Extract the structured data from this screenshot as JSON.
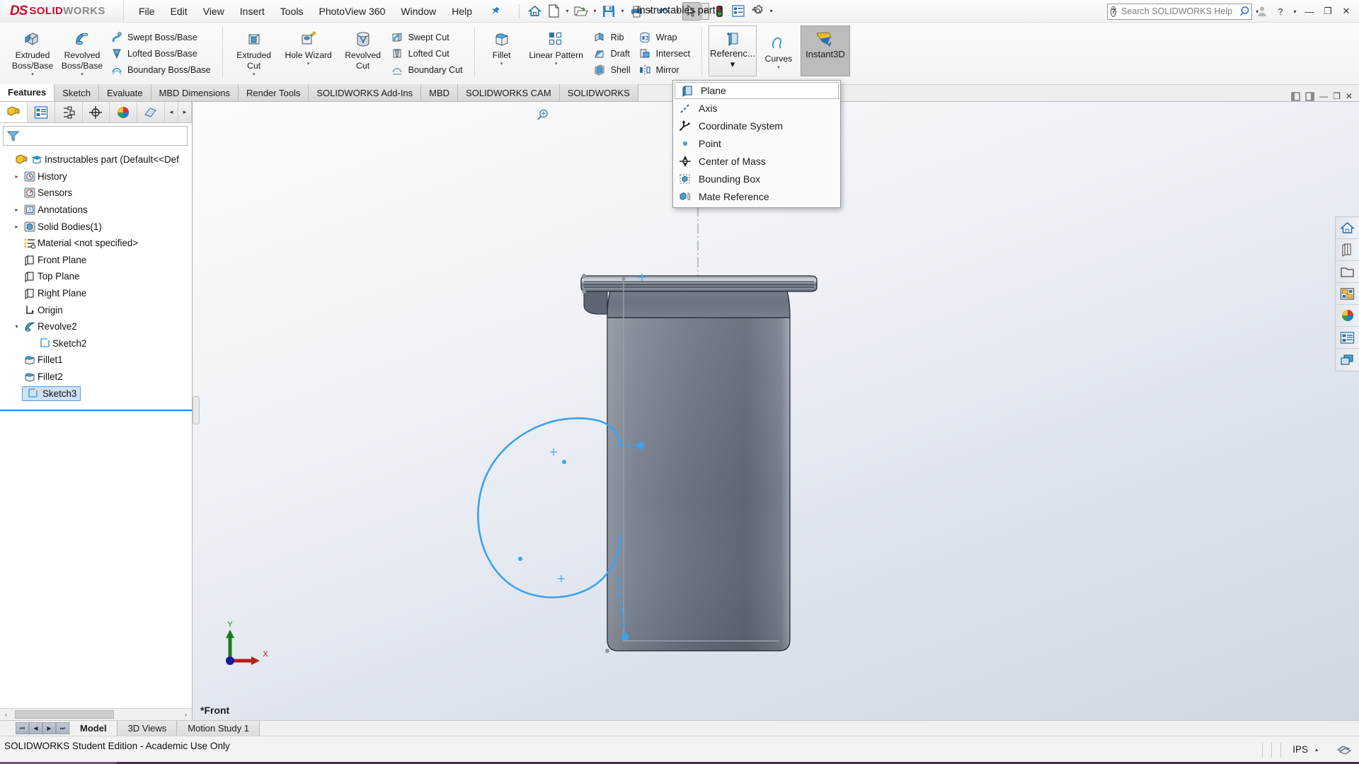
{
  "app": {
    "brand_mark": "DS",
    "brand_solid": "SOLID",
    "brand_works": "WORKS",
    "document_title": "Instructables part *",
    "accent_color": "#cf0a2c"
  },
  "menubar": {
    "items": [
      {
        "label": "File"
      },
      {
        "label": "Edit"
      },
      {
        "label": "View"
      },
      {
        "label": "Insert"
      },
      {
        "label": "Tools"
      },
      {
        "label": "PhotoView 360"
      },
      {
        "label": "Window"
      },
      {
        "label": "Help"
      }
    ],
    "pin_icon": "pushpin-icon"
  },
  "quick_access": {
    "buttons": [
      {
        "name": "home-icon"
      },
      {
        "name": "new-document-icon"
      },
      {
        "name": "open-folder-icon"
      },
      {
        "name": "save-icon"
      },
      {
        "name": "print-icon"
      },
      {
        "name": "undo-icon"
      },
      {
        "name": "select-cursor-icon"
      },
      {
        "name": "rebuild-traffic-light-icon"
      },
      {
        "name": "options-list-icon"
      },
      {
        "name": "settings-gear-icon"
      }
    ]
  },
  "search": {
    "placeholder": "Search SOLIDWORKS Help",
    "value": "",
    "help_icon": "question-circle-icon",
    "magnifier_icon": "magnifier-icon"
  },
  "window_controls": {
    "account": "user-account-icon",
    "help": "?",
    "help_caret": "▾",
    "minimize": "—",
    "restore": "❐",
    "close": "✕"
  },
  "ribbon": {
    "groups": [
      {
        "name": "boss-base-group",
        "big": [
          {
            "label_line1": "Extruded",
            "label_line2": "Boss/Base",
            "icon": "extruded-boss-icon",
            "dropdown": true
          },
          {
            "label_line1": "Revolved",
            "label_line2": "Boss/Base",
            "icon": "revolved-boss-icon",
            "dropdown": true
          }
        ],
        "small": [
          {
            "label": "Swept Boss/Base",
            "icon": "swept-boss-icon"
          },
          {
            "label": "Lofted Boss/Base",
            "icon": "lofted-boss-icon"
          },
          {
            "label": "Boundary Boss/Base",
            "icon": "boundary-boss-icon"
          }
        ]
      },
      {
        "name": "cut-group",
        "big": [
          {
            "label_line1": "Extruded",
            "label_line2": "Cut",
            "icon": "extruded-cut-icon",
            "dropdown": true
          },
          {
            "label_line1": "Hole Wizard",
            "label_line2": "",
            "icon": "hole-wizard-icon",
            "dropdown": true
          },
          {
            "label_line1": "Revolved",
            "label_line2": "Cut",
            "icon": "revolved-cut-icon",
            "dropdown": false
          }
        ],
        "small": [
          {
            "label": "Swept Cut",
            "icon": "swept-cut-icon"
          },
          {
            "label": "Lofted Cut",
            "icon": "lofted-cut-icon"
          },
          {
            "label": "Boundary Cut",
            "icon": "boundary-cut-icon"
          }
        ]
      },
      {
        "name": "features-group",
        "big": [
          {
            "label_line1": "Fillet",
            "label_line2": "",
            "icon": "fillet-icon",
            "dropdown": true
          },
          {
            "label_line1": "Linear Pattern",
            "label_line2": "",
            "icon": "linear-pattern-icon",
            "dropdown": true
          }
        ],
        "small": [
          {
            "label": "Rib",
            "icon": "rib-icon"
          },
          {
            "label": "Draft",
            "icon": "draft-icon"
          },
          {
            "label": "Shell",
            "icon": "shell-icon"
          }
        ],
        "small2": [
          {
            "label": "Wrap",
            "icon": "wrap-icon"
          },
          {
            "label": "Intersect",
            "icon": "intersect-icon"
          },
          {
            "label": "Mirror",
            "icon": "mirror-icon"
          }
        ]
      },
      {
        "name": "reference-group",
        "reference": {
          "label": "Referenc...",
          "icon": "reference-geometry-plane-icon",
          "dropdown": true,
          "active": true
        },
        "curves": {
          "label": "Curves",
          "icon": "curves-icon",
          "dropdown": true
        },
        "instant3d": {
          "label": "Instant3D",
          "icon": "instant3d-icon",
          "pressed": true
        }
      }
    ]
  },
  "ribbon_tabs": {
    "items": [
      {
        "label": "Features",
        "active": true
      },
      {
        "label": "Sketch",
        "active": false
      },
      {
        "label": "Evaluate",
        "active": false
      },
      {
        "label": "MBD Dimensions",
        "active": false
      },
      {
        "label": "Render Tools",
        "active": false
      },
      {
        "label": "SOLIDWORKS Add-Ins",
        "active": false
      },
      {
        "label": "MBD",
        "active": false
      },
      {
        "label": "SOLIDWORKS CAM",
        "active": false
      },
      {
        "label": "SOLIDWORKS",
        "active": false
      }
    ],
    "right_controls": [
      {
        "name": "panel-collapse-left-icon",
        "glyph": "⎮|"
      },
      {
        "name": "panel-collapse-right-icon",
        "glyph": "|⎮"
      },
      {
        "name": "window-minimize-icon",
        "glyph": "—"
      },
      {
        "name": "window-restore-icon",
        "glyph": "❐"
      },
      {
        "name": "window-close-icon",
        "glyph": "✕"
      }
    ]
  },
  "reference_dropdown": {
    "open": true,
    "items": [
      {
        "label": "Plane",
        "icon": "plane-icon",
        "highlighted": true
      },
      {
        "label": "Axis",
        "icon": "axis-icon",
        "highlighted": false
      },
      {
        "label": "Coordinate System",
        "icon": "coordinate-system-icon",
        "highlighted": false
      },
      {
        "label": "Point",
        "icon": "point-icon",
        "highlighted": false
      },
      {
        "label": "Center of Mass",
        "icon": "center-of-mass-icon",
        "highlighted": false
      },
      {
        "label": "Bounding Box",
        "icon": "bounding-box-icon",
        "highlighted": false
      },
      {
        "label": "Mate Reference",
        "icon": "mate-reference-icon",
        "highlighted": false
      }
    ]
  },
  "left_panel": {
    "tabs": [
      {
        "name": "feature-manager-tab",
        "icon": "feature-tree-icon",
        "active": true
      },
      {
        "name": "property-manager-tab",
        "icon": "property-manager-icon",
        "active": false
      },
      {
        "name": "configuration-manager-tab",
        "icon": "configuration-manager-icon",
        "active": false
      },
      {
        "name": "dimxpert-manager-tab",
        "icon": "dimxpert-icon",
        "active": false
      },
      {
        "name": "display-manager-tab",
        "icon": "display-manager-icon",
        "active": false
      },
      {
        "name": "extra-manager-tab",
        "icon": "cam-manager-icon",
        "active": false
      }
    ],
    "arrows": [
      "◂",
      "▸"
    ],
    "filter": {
      "placeholder": "",
      "value": "",
      "icon": "filter-funnel-icon"
    },
    "tree": [
      {
        "label": "Instructables part  (Default<<Def",
        "icon": "part-doc-icon",
        "icon2": "graduation-cap-icon",
        "indent": 0,
        "expander": "",
        "selected": false
      },
      {
        "label": "History",
        "icon": "history-icon",
        "indent": 1,
        "expander": "▸",
        "selected": false
      },
      {
        "label": "Sensors",
        "icon": "sensors-icon",
        "indent": 1,
        "expander": "",
        "selected": false
      },
      {
        "label": "Annotations",
        "icon": "annotations-icon",
        "indent": 1,
        "expander": "▸",
        "selected": false
      },
      {
        "label": "Solid Bodies(1)",
        "icon": "solid-bodies-icon",
        "indent": 1,
        "expander": "▸",
        "selected": false
      },
      {
        "label": "Material <not specified>",
        "icon": "material-icon",
        "indent": 1,
        "expander": "",
        "selected": false
      },
      {
        "label": "Front Plane",
        "icon": "plane-tree-icon",
        "indent": 1,
        "expander": "",
        "selected": false
      },
      {
        "label": "Top Plane",
        "icon": "plane-tree-icon",
        "indent": 1,
        "expander": "",
        "selected": false
      },
      {
        "label": "Right Plane",
        "icon": "plane-tree-icon",
        "indent": 1,
        "expander": "",
        "selected": false
      },
      {
        "label": "Origin",
        "icon": "origin-icon",
        "indent": 1,
        "expander": "",
        "selected": false
      },
      {
        "label": "Revolve2",
        "icon": "revolve-icon",
        "indent": 1,
        "expander": "▾",
        "selected": false
      },
      {
        "label": "Sketch2",
        "icon": "sketch-icon",
        "indent": 2,
        "expander": "",
        "selected": false
      },
      {
        "label": "Fillet1",
        "icon": "fillet-tree-icon",
        "indent": 1,
        "expander": "",
        "selected": false
      },
      {
        "label": "Fillet2",
        "icon": "fillet-tree-icon",
        "indent": 1,
        "expander": "",
        "selected": false
      },
      {
        "label": "Sketch3",
        "icon": "sketch-icon",
        "indent": 1,
        "expander": "",
        "selected": true
      }
    ],
    "hscroll": {
      "left_arrow": "‹",
      "right_arrow": "›"
    }
  },
  "viewport": {
    "view_label": "*Front",
    "triad": {
      "x_label": "X",
      "y_label": "Y",
      "x_color": "#cc0000",
      "y_color": "#007700"
    },
    "toolbar": [
      {
        "name": "zoom-to-area-icon"
      },
      {
        "name": "view-orientation-icon"
      },
      {
        "name": "display-style-icon"
      },
      {
        "name": "hide-show-items-icon"
      },
      {
        "name": "edit-appearance-icon",
        "caret": true
      },
      {
        "name": "apply-scene-icon",
        "caret": true
      },
      {
        "name": "view-settings-icon",
        "caret": true
      }
    ],
    "sketch_color": "#3ca2f0",
    "model_color": "#6b7280"
  },
  "right_toolbar": {
    "items": [
      {
        "name": "home-view-icon"
      },
      {
        "name": "design-library-icon"
      },
      {
        "name": "file-explorer-icon"
      },
      {
        "name": "view-palette-icon"
      },
      {
        "name": "appearances-scenes-icon"
      },
      {
        "name": "custom-properties-icon"
      },
      {
        "name": "display-manager-side-icon"
      }
    ]
  },
  "bottom_tabs": {
    "nav_buttons": [
      "⏮",
      "◀",
      "▶",
      "⏭"
    ],
    "items": [
      {
        "label": "Model",
        "active": true
      },
      {
        "label": "3D Views",
        "active": false
      },
      {
        "label": "Motion Study 1",
        "active": false
      }
    ]
  },
  "status_bar": {
    "message": "SOLIDWORKS Student Edition - Academic Use Only",
    "units": "IPS",
    "units_caret": "▴",
    "overlay_icon": "overlay-icon"
  }
}
